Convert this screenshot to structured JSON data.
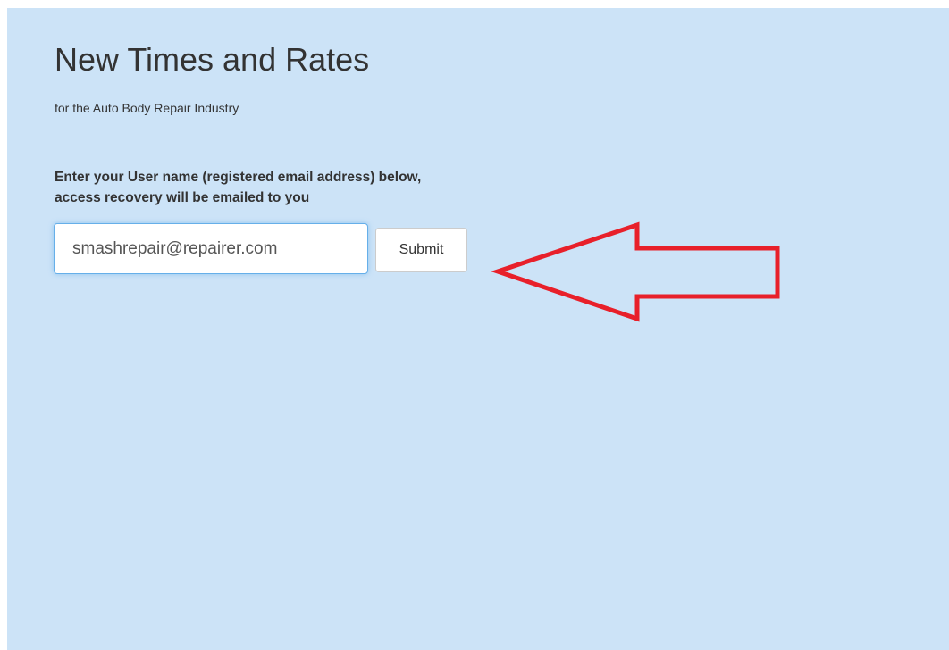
{
  "header": {
    "title": "New Times and Rates",
    "subtitle": "for the Auto Body Repair Industry"
  },
  "form": {
    "instruction_line1": "Enter your User name (registered email address) below,",
    "instruction_line2": "access recovery will be emailed to you",
    "email_value": "smashrepair@repairer.com",
    "submit_label": "Submit"
  },
  "annotation": {
    "arrow_color": "#e8202a",
    "icon": "arrow-left-icon"
  },
  "colors": {
    "background": "#cce3f7",
    "text": "#333333",
    "input_focus": "#66afe9"
  }
}
